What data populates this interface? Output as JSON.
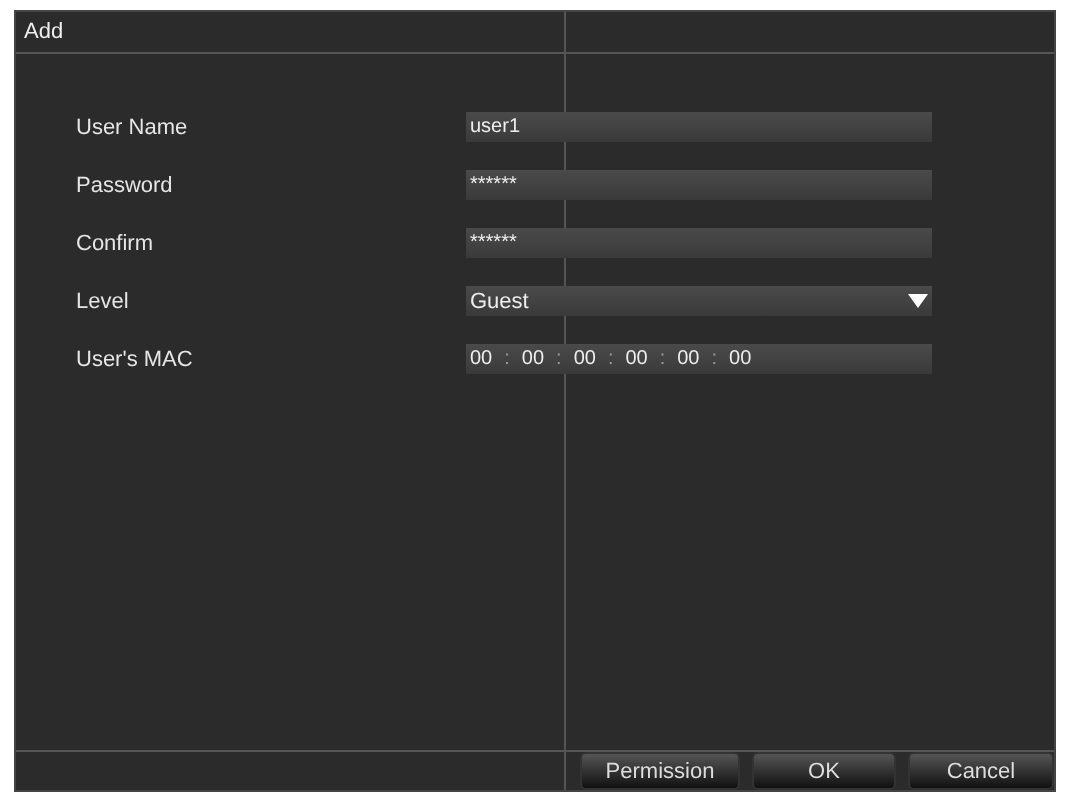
{
  "window": {
    "title": "Add"
  },
  "fields": [
    {
      "label": "User Name",
      "kind": "text",
      "value": "user1"
    },
    {
      "label": "Password",
      "kind": "text",
      "value": "******"
    },
    {
      "label": "Confirm",
      "kind": "text",
      "value": "******"
    },
    {
      "label": "Level",
      "kind": "select",
      "value": "Guest"
    },
    {
      "label": "User's MAC",
      "kind": "mac",
      "parts": [
        "00",
        "00",
        "00",
        "00",
        "00",
        "00"
      ],
      "separator": ":"
    }
  ],
  "buttons": [
    "Permission",
    "OK",
    "Cancel"
  ]
}
